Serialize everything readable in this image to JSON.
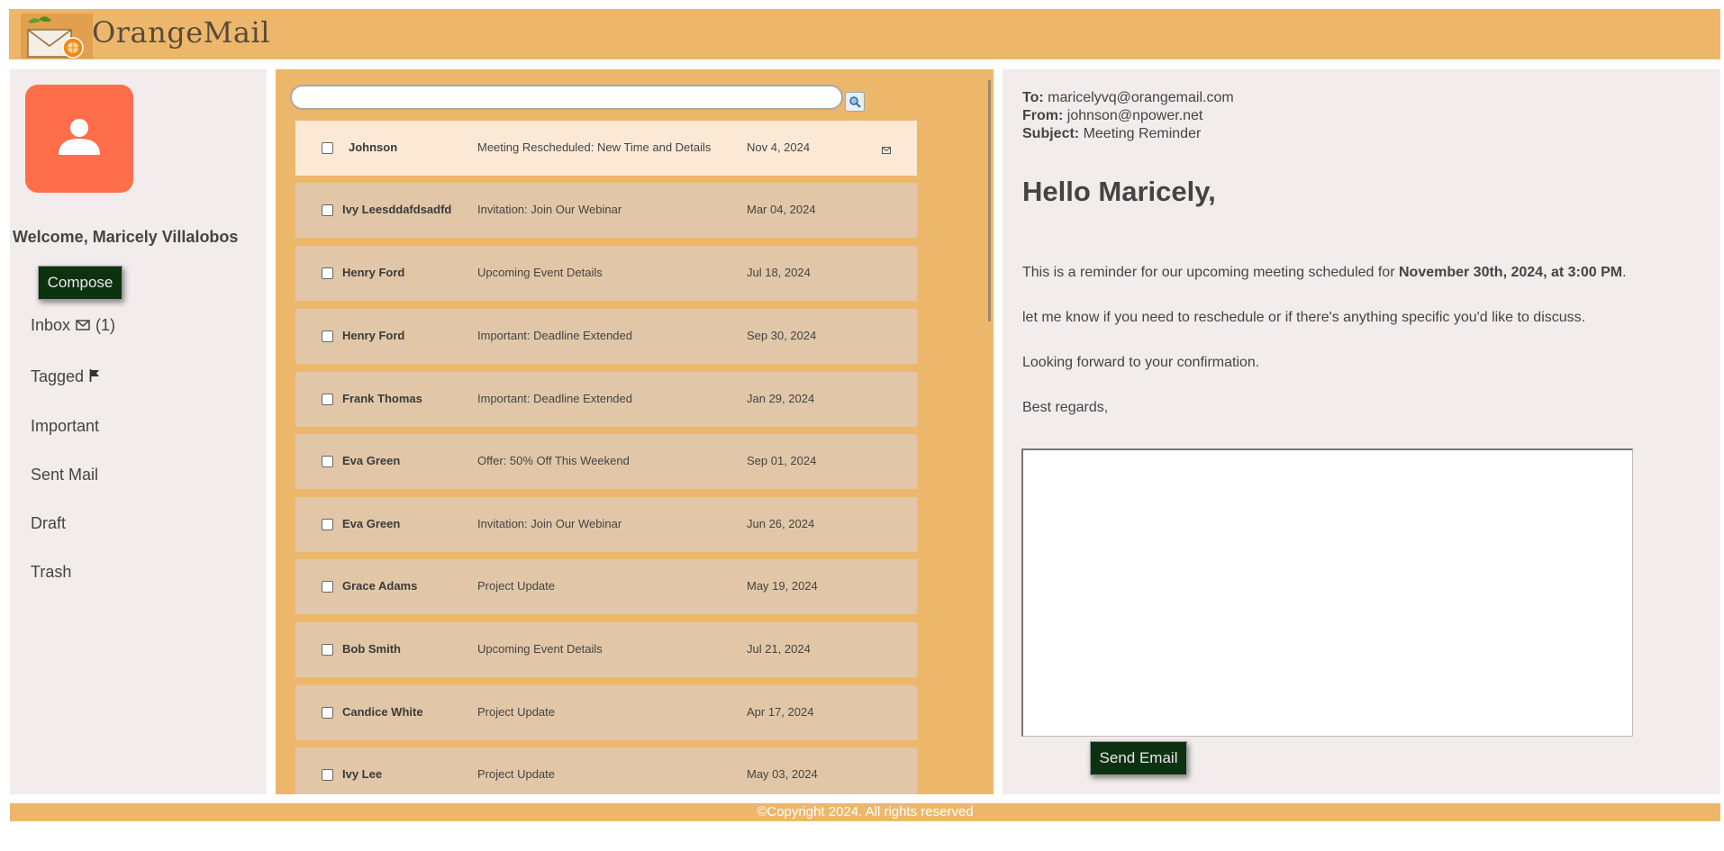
{
  "app": {
    "brand": "OrangeMail"
  },
  "colors": {
    "accent": "#edb76b",
    "panel_bg": "#f2ecec",
    "avatar_bg": "#fe6e4a",
    "button_bg": "#0d3210",
    "row_bg": "#e1c7a7",
    "row_active_bg": "#fbe9d6"
  },
  "sidebar": {
    "avatar_icon": "user-icon",
    "welcome": "Welcome, Maricely Villalobos",
    "compose_label": "Compose",
    "items": [
      {
        "label": "Inbox",
        "icon": "envelope-icon",
        "count": "(1)"
      },
      {
        "label": "Tagged",
        "icon": "flag-icon"
      },
      {
        "label": "Important"
      },
      {
        "label": "Sent Mail"
      },
      {
        "label": "Draft"
      },
      {
        "label": "Trash"
      }
    ]
  },
  "search": {
    "value": "",
    "button_icon": "search-icon"
  },
  "emails": [
    {
      "sender": "Johnson",
      "subject": "Meeting Rescheduled: New Time and Details",
      "date": "Nov 4, 2024",
      "unread": true
    },
    {
      "sender": "Ivy Leesddafdsadfd",
      "subject": "Invitation: Join Our Webinar",
      "date": "Mar 04, 2024"
    },
    {
      "sender": "Henry Ford",
      "subject": "Upcoming Event Details",
      "date": "Jul 18, 2024"
    },
    {
      "sender": "Henry Ford",
      "subject": "Important: Deadline Extended",
      "date": "Sep 30, 2024"
    },
    {
      "sender": "Frank Thomas",
      "subject": "Important: Deadline Extended",
      "date": "Jan 29, 2024"
    },
    {
      "sender": "Eva Green",
      "subject": "Offer: 50% Off This Weekend",
      "date": "Sep 01, 2024"
    },
    {
      "sender": "Eva Green",
      "subject": "Invitation: Join Our Webinar",
      "date": "Jun 26, 2024"
    },
    {
      "sender": "Grace Adams",
      "subject": "Project Update",
      "date": "May 19, 2024"
    },
    {
      "sender": "Bob Smith",
      "subject": "Upcoming Event Details",
      "date": "Jul 21, 2024"
    },
    {
      "sender": "Candice White",
      "subject": "Project Update",
      "date": "Apr 17, 2024"
    },
    {
      "sender": "Ivy Lee",
      "subject": "Project Update",
      "date": "May 03, 2024"
    }
  ],
  "message": {
    "to_label": "To:",
    "to": "maricelyvq@orangemail.com",
    "from_label": "From:",
    "from": "johnson@npower.net",
    "subject_label": "Subject:",
    "subject": "Meeting Reminder",
    "greeting": "Hello Maricely,",
    "body_1_prefix": "This is a reminder for our upcoming meeting scheduled for ",
    "body_1_bold": "November 30th, 2024, at 3:00 PM",
    "body_1_suffix": ".",
    "body_2": "let me know if you need to reschedule or if there's anything specific you'd like to discuss.",
    "body_3": "Looking forward to your confirmation.",
    "body_4": "Best regards,",
    "reply_value": "",
    "send_label": "Send Email"
  },
  "footer": {
    "text": "©Copyright 2024. All rights reserved"
  }
}
